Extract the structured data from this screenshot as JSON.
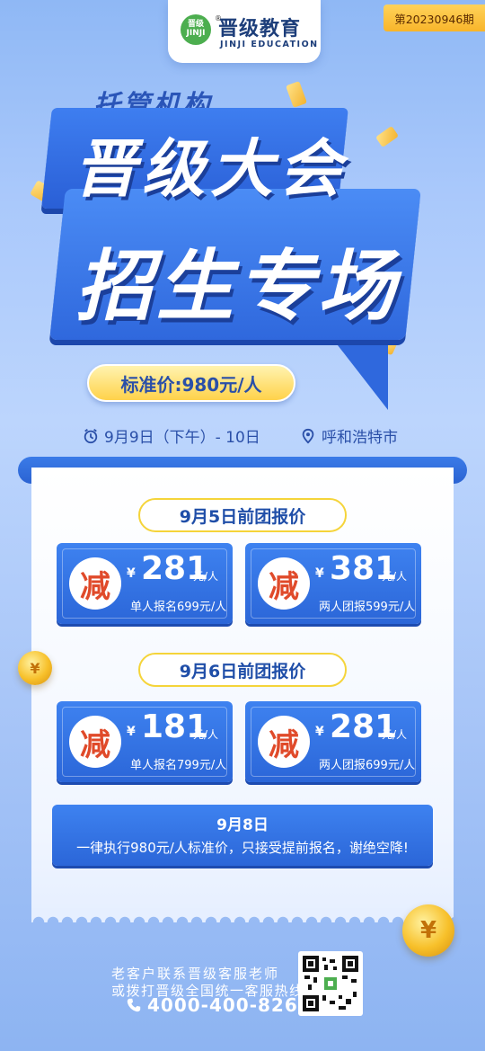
{
  "logo": {
    "mark_text": "晋级 JINJI",
    "name_cn": "晋级教育",
    "name_en": "JINJI EDUCATION",
    "reg": "®"
  },
  "issue": "第20230946期",
  "headline": {
    "org": "托管机构",
    "line1": "晋级大会",
    "line2": "招生专场",
    "price": "标准价:980元/人"
  },
  "event": {
    "date": "9月9日（下午）- 10日",
    "city": "呼和浩特市"
  },
  "sections": [
    {
      "title": "9月5日前团报价",
      "deals": [
        {
          "badge": "减",
          "currency": "¥",
          "amount": "281",
          "unit": "元/人",
          "note": "单人报名699元/人"
        },
        {
          "badge": "减",
          "currency": "¥",
          "amount": "381",
          "unit": "元/人",
          "note": "两人团报599元/人"
        }
      ]
    },
    {
      "title": "9月6日前团报价",
      "deals": [
        {
          "badge": "减",
          "currency": "¥",
          "amount": "181",
          "unit": "元/人",
          "note": "单人报名799元/人"
        },
        {
          "badge": "减",
          "currency": "¥",
          "amount": "281",
          "unit": "元/人",
          "note": "两人团报699元/人"
        }
      ]
    }
  ],
  "final": {
    "title": "9月8日",
    "desc": "一律执行980元/人标准价，只接受提前报名，谢绝空降!"
  },
  "coin_symbol": "¥",
  "contact": {
    "line1": "老客户联系晋级客服老师",
    "line2": "或拨打晋级全国统一客服热线",
    "phone": "4000-400-826"
  },
  "colors": {
    "primary": "#2b66d8",
    "accent": "#f7c02a",
    "badge_text": "#e04a2a"
  }
}
